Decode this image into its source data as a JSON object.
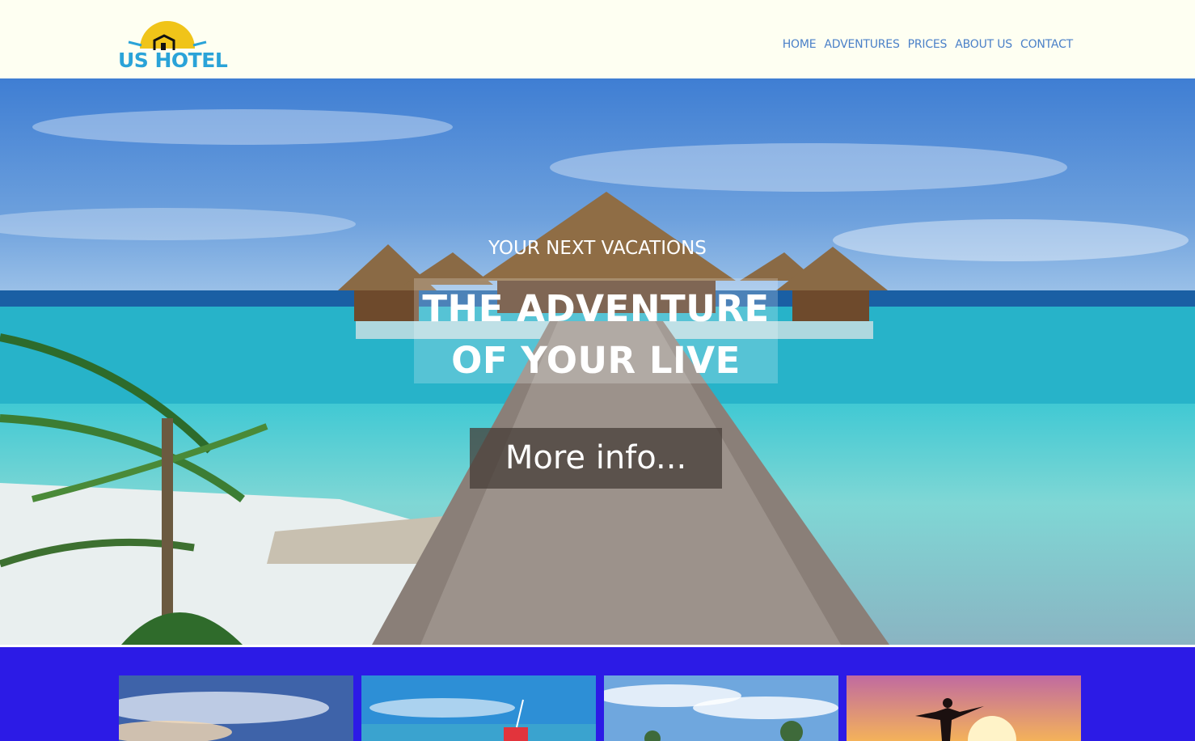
{
  "brand": {
    "name": "US HOTEL"
  },
  "nav": [
    "HOME",
    "ADVENTURES",
    "PRICES",
    "ABOUT US",
    "CONTACT"
  ],
  "hero": {
    "subtitle": "YOUR NEXT VACATIONS",
    "title_line1": "THE ADVENTURE",
    "title_line2": "OF YOUR LIVE",
    "button": "More info..."
  },
  "colors": {
    "band": "#2c1be6",
    "nav_link": "#4a80c8",
    "logo_text": "#2aa3d8",
    "logo_sun": "#f0c419"
  }
}
